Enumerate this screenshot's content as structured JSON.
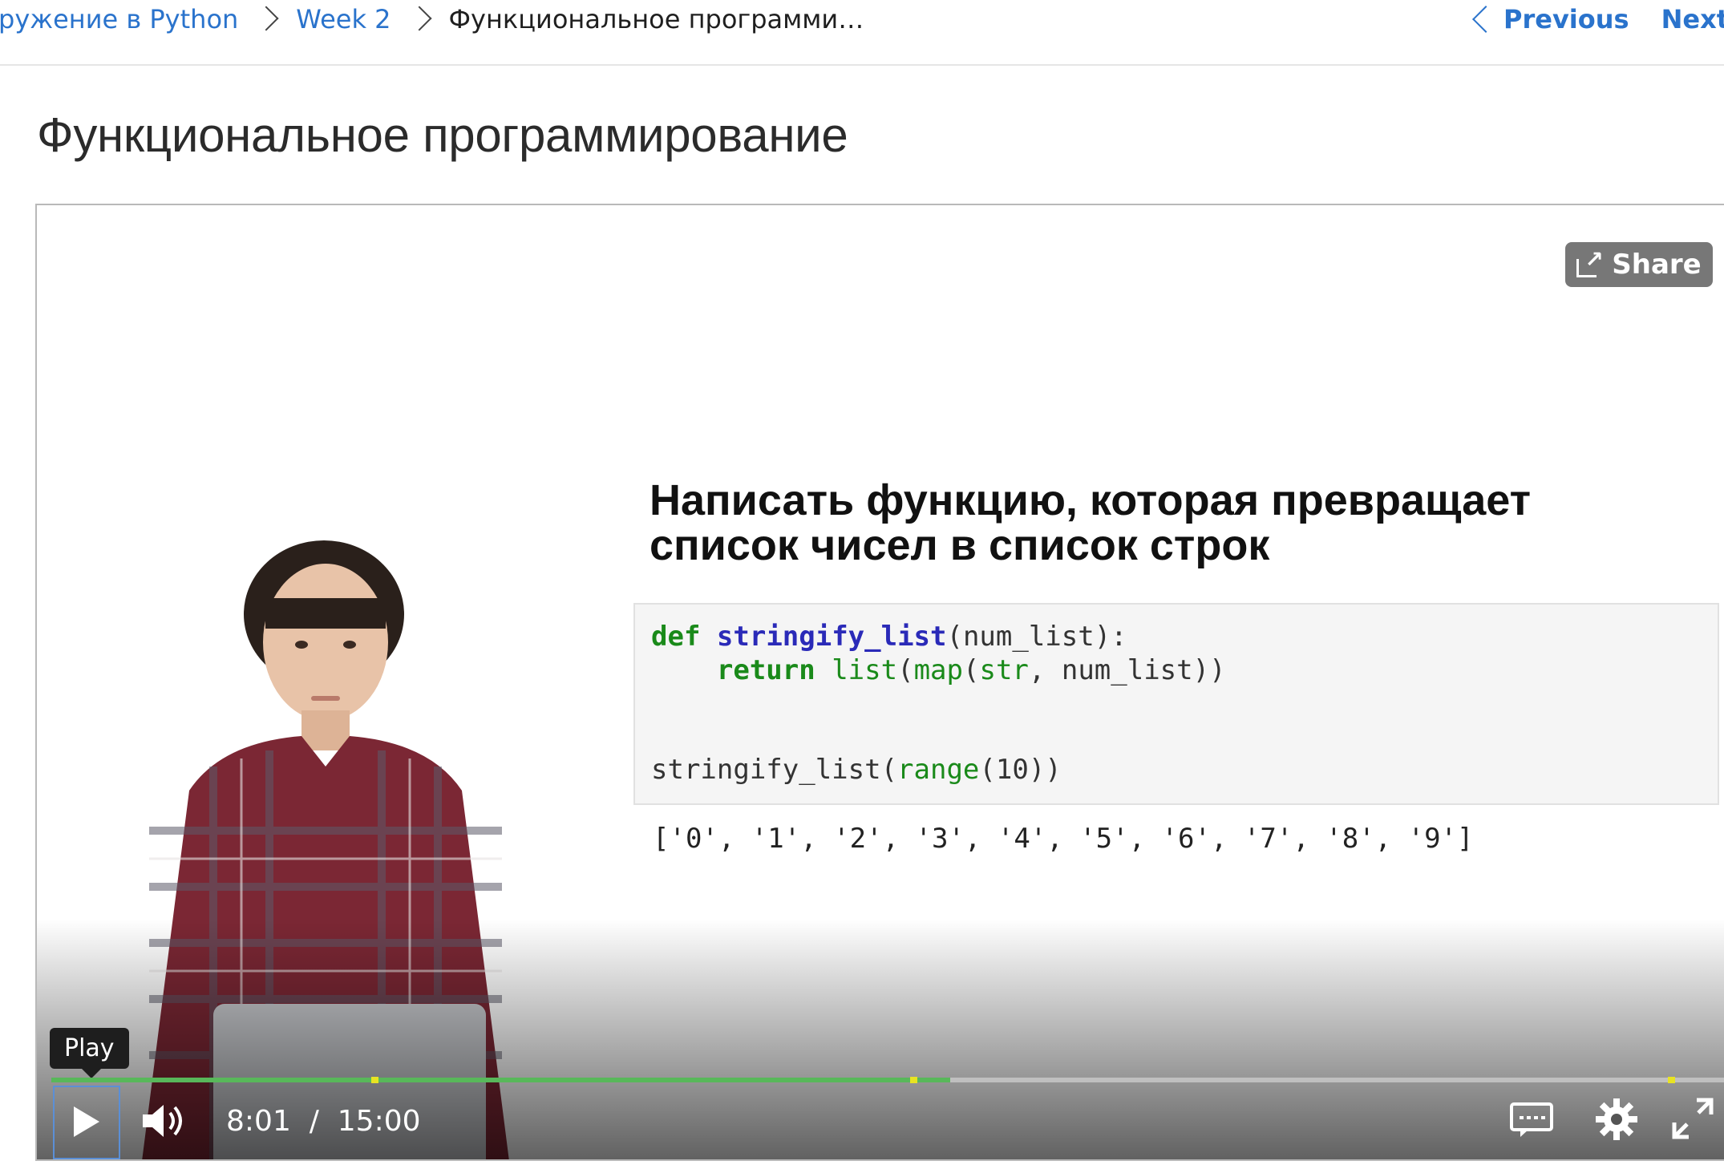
{
  "breadcrumb": {
    "items": [
      {
        "label": "ружение в Python"
      },
      {
        "label": "Week 2"
      },
      {
        "label": "Функциональное программи…"
      }
    ]
  },
  "nav": {
    "previous_label": "Previous",
    "next_label": "Next"
  },
  "page": {
    "title": "Функциональное программирование"
  },
  "player": {
    "share_label": "Share",
    "tooltip": "Play",
    "current_time": "8:01",
    "time_separator": "/",
    "duration": "15:00",
    "progress_fraction": 0.534,
    "buffered_fraction": 0.534,
    "chapter_markers": [
      0.19,
      0.51,
      0.96
    ]
  },
  "slide": {
    "heading_line1": "Написать функцию, которая превращает",
    "heading_line2": "список чисел в список строк",
    "code": {
      "line1_kw": "def",
      "line1_fn": "stringify_list",
      "line1_rest": "(num_list):",
      "line2_kw": "return",
      "line2_bi1": "list",
      "line2_paren": "(",
      "line2_bi2": "map",
      "line2_paren2": "(",
      "line2_bi3": "str",
      "line2_rest": ", num_list))",
      "line3_fn": "stringify_list(",
      "line3_bi": "range",
      "line3_rest": "(10))"
    },
    "output": "['0', '1', '2', '3', '4', '5', '6', '7', '8', '9']"
  },
  "colors": {
    "link": "#2a73cc",
    "progress": "#58b85a",
    "marker": "#e8e322",
    "share_bg": "#777777"
  }
}
